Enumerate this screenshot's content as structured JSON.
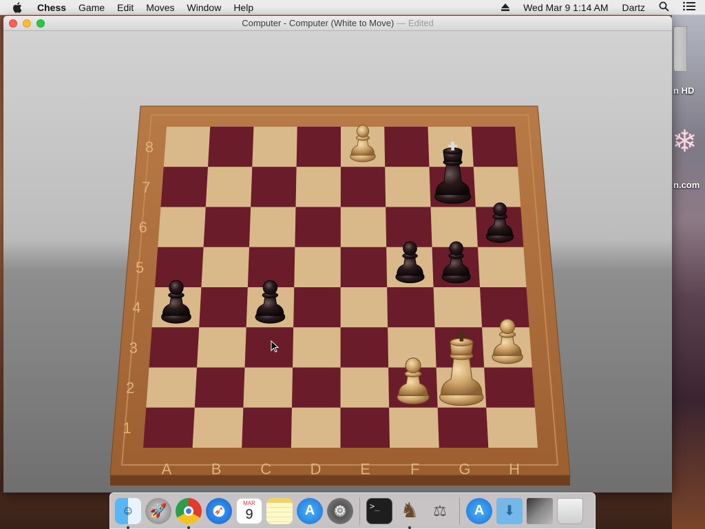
{
  "menubar": {
    "app_name": "Chess",
    "items": [
      "Game",
      "Edit",
      "Moves",
      "Window",
      "Help"
    ],
    "clock": "Wed Mar 9  1:14 AM",
    "user": "Dartz"
  },
  "window": {
    "title": "Computer - Computer   (White to Move)",
    "edited": "— Edited"
  },
  "board": {
    "files": [
      "A",
      "B",
      "C",
      "D",
      "E",
      "F",
      "G",
      "H"
    ],
    "ranks": [
      "1",
      "2",
      "3",
      "4",
      "5",
      "6",
      "7",
      "8"
    ],
    "pieces": [
      {
        "square": "e8",
        "color": "white",
        "type": "pawn"
      },
      {
        "square": "g7",
        "color": "black",
        "type": "king"
      },
      {
        "square": "h6",
        "color": "black",
        "type": "pawn"
      },
      {
        "square": "f5",
        "color": "black",
        "type": "pawn"
      },
      {
        "square": "g5",
        "color": "black",
        "type": "pawn"
      },
      {
        "square": "a4",
        "color": "black",
        "type": "pawn"
      },
      {
        "square": "c4",
        "color": "black",
        "type": "pawn"
      },
      {
        "square": "h3",
        "color": "white",
        "type": "pawn"
      },
      {
        "square": "f2",
        "color": "white",
        "type": "pawn"
      },
      {
        "square": "g2",
        "color": "white",
        "type": "king"
      }
    ]
  },
  "desktop": {
    "labels": [
      "n HD",
      "n.com"
    ]
  },
  "dock": {
    "date_icon_month": "MAR",
    "date_icon_day": "9"
  },
  "colors": {
    "dark_square": "#6b1c2a",
    "light_square": "#d9b98a",
    "frame": "#a4673a"
  }
}
